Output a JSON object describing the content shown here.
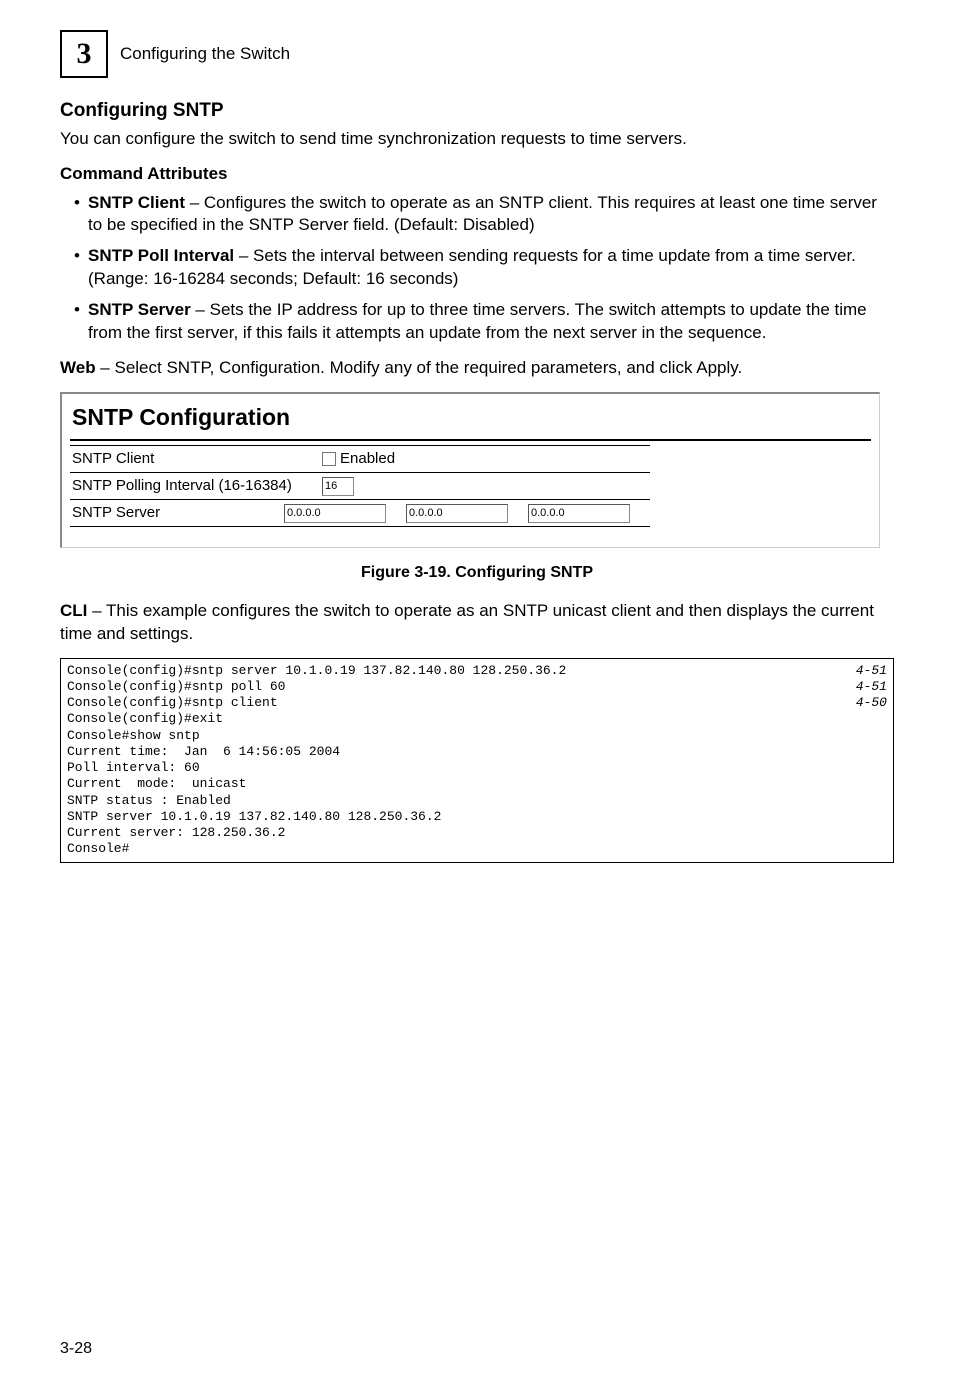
{
  "header": {
    "chapter_number": "3",
    "running_title": "Configuring the Switch"
  },
  "section": {
    "title": "Configuring SNTP",
    "intro": "You can configure the switch to send time synchronization requests to time servers.",
    "attrs_heading": "Command Attributes",
    "bullets": [
      {
        "term": "SNTP Client",
        "desc": " – Configures the switch to operate as an SNTP client. This requires at least one time server to be specified in the SNTP Server field. (Default: Disabled)"
      },
      {
        "term": "SNTP Poll Interval",
        "desc": " – Sets the interval between sending requests for a time update from a time server. (Range: 16-16284 seconds; Default: 16 seconds)"
      },
      {
        "term": "SNTP Server",
        "desc": " – Sets the IP address for up to three time servers. The switch attempts to update the time from the first server, if this fails it attempts an update from the next server in the sequence."
      }
    ],
    "web_label": "Web",
    "web_text": " – Select SNTP, Configuration. Modify any of the required parameters, and click Apply."
  },
  "panel": {
    "title": "SNTP Configuration",
    "row1_label": "SNTP Client",
    "row1_checkbox_label": "Enabled",
    "row2_label": "SNTP Polling Interval (16-16384)",
    "row2_value": "16",
    "row3_label": "SNTP Server",
    "server_values": [
      "0.0.0.0",
      "0.0.0.0",
      "0.0.0.0"
    ]
  },
  "figure_caption": "Figure 3-19.  Configuring SNTP",
  "cli_intro": {
    "label": "CLI",
    "text": " – This example configures the switch to operate as an SNTP unicast client and then displays the current time and settings."
  },
  "cli": [
    {
      "txt": "Console(config)#sntp server 10.1.0.19 137.82.140.80 128.250.36.2",
      "ref": "4-51"
    },
    {
      "txt": "Console(config)#sntp poll 60",
      "ref": "4-51"
    },
    {
      "txt": "Console(config)#sntp client",
      "ref": "4-50"
    },
    {
      "txt": "Console(config)#exit",
      "ref": ""
    },
    {
      "txt": "Console#show sntp",
      "ref": ""
    },
    {
      "txt": "Current time:  Jan  6 14:56:05 2004",
      "ref": ""
    },
    {
      "txt": "Poll interval: 60",
      "ref": ""
    },
    {
      "txt": "Current  mode:  unicast",
      "ref": ""
    },
    {
      "txt": "SNTP status : Enabled",
      "ref": ""
    },
    {
      "txt": "SNTP server 10.1.0.19 137.82.140.80 128.250.36.2",
      "ref": ""
    },
    {
      "txt": "Current server: 128.250.36.2",
      "ref": ""
    },
    {
      "txt": "Console#",
      "ref": ""
    }
  ],
  "page_number": "3-28"
}
